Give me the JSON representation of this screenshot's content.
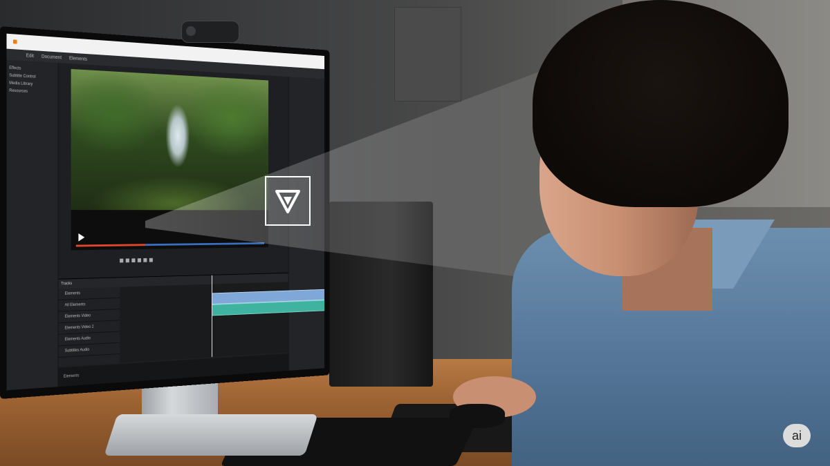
{
  "app": {
    "menu_items": [
      "Edit",
      "Document",
      "Elements"
    ],
    "left_panel_items": [
      "Effects",
      "Subtitle Control",
      "Media Library",
      "Resources"
    ],
    "timeline_header": "Tracks",
    "track_labels": [
      "Elements",
      "All Elements",
      "Elements Video",
      "Elements Video 2",
      "Elements Audio",
      "Subtitles Audio"
    ],
    "status_text": "Elements"
  },
  "colors": {
    "accent_orange": "#ff7a00",
    "progress_red": "#e0472b",
    "progress_blue": "#3a6fbf",
    "video_clip": "#7fa7d8",
    "audio_clip": "#3fb3a0"
  },
  "icons": [
    "play-icon",
    "logo-triangle-icon",
    "ai-badge-icon",
    "webcam-icon"
  ],
  "badge": {
    "label": "ai"
  }
}
